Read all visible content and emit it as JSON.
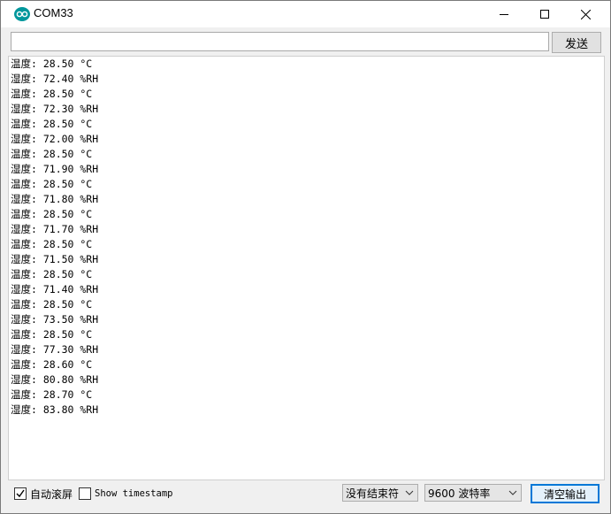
{
  "window": {
    "title": "COM33",
    "app_icon": "arduino-logo-icon"
  },
  "send": {
    "input_value": "",
    "button_label": "发送"
  },
  "output_lines": [
    "温度: 28.50 °C",
    "湿度: 72.40 %RH",
    "温度: 28.50 °C",
    "湿度: 72.30 %RH",
    "温度: 28.50 °C",
    "湿度: 72.00 %RH",
    "温度: 28.50 °C",
    "湿度: 71.90 %RH",
    "温度: 28.50 °C",
    "湿度: 71.80 %RH",
    "温度: 28.50 °C",
    "湿度: 71.70 %RH",
    "温度: 28.50 °C",
    "湿度: 71.50 %RH",
    "温度: 28.50 °C",
    "湿度: 71.40 %RH",
    "温度: 28.50 °C",
    "湿度: 73.50 %RH",
    "温度: 28.50 °C",
    "湿度: 77.30 %RH",
    "温度: 28.60 °C",
    "湿度: 80.80 %RH",
    "温度: 28.70 °C",
    "湿度: 83.80 %RH"
  ],
  "status": {
    "autoscroll": {
      "label": "自动滚屏",
      "checked": true
    },
    "timestamp": {
      "label": "Show timestamp",
      "checked": false
    },
    "line_ending": "没有结束符",
    "baud_rate": "9600 波特率",
    "clear_button": "清空输出"
  },
  "colors": {
    "accent": "#0078d7",
    "app_icon": "#00979c"
  }
}
